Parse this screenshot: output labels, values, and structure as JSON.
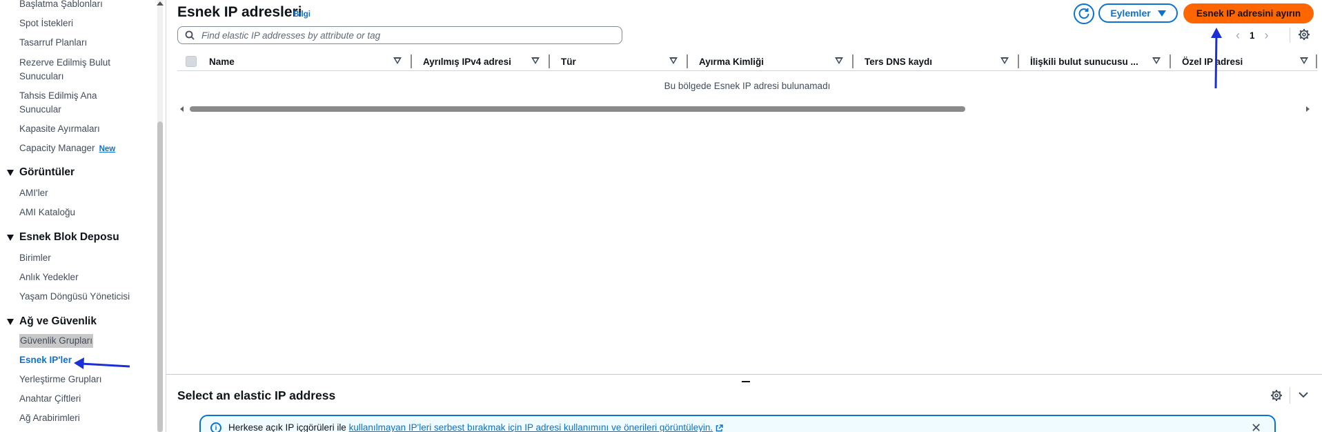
{
  "sidebar": {
    "items_top": [
      {
        "label": "Başlatma Şablonları"
      },
      {
        "label": "Spot İstekleri"
      },
      {
        "label": "Tasarruf Planları"
      },
      {
        "label": "Rezerve Edilmiş Bulut Sunucuları"
      },
      {
        "label": "Tahsis Edilmiş Ana Sunucular"
      },
      {
        "label": "Kapasite Ayırmaları"
      },
      {
        "label": "Capacity Manager",
        "badge": "New"
      }
    ],
    "sections": [
      {
        "title": "Görüntüler",
        "items": [
          "AMI'ler",
          "AMI Kataloğu"
        ]
      },
      {
        "title": "Esnek Blok Deposu",
        "items": [
          "Birimler",
          "Anlık Yedekler",
          "Yaşam Döngüsü Yöneticisi"
        ]
      },
      {
        "title": "Ağ ve Güvenlik",
        "items": [
          "Güvenlik Grupları",
          "Esnek IP'ler",
          "Yerleştirme Grupları",
          "Anahtar Çiftleri",
          "Ağ Arabirimleri"
        ]
      }
    ]
  },
  "main": {
    "title": "Esnek IP adresleri",
    "info_link": "Bilgi",
    "actions_label": "Eylemler",
    "allocate_label": "Esnek IP adresini ayırın",
    "search_placeholder": "Find elastic IP addresses by attribute or tag",
    "page_number": "1",
    "columns": [
      "Name",
      "Ayrılmış IPv4 adresi",
      "Tür",
      "Ayırma Kimliği",
      "Ters DNS kaydı",
      "İlişkili bulut sunucusu ...",
      "Özel IP adresi"
    ],
    "empty_message": "Bu bölgede Esnek IP adresi bulunamadı"
  },
  "split_panel": {
    "title": "Select an elastic IP address",
    "alert_prefix": "Herkese açık IP içgörüleri ile ",
    "alert_link": "kullanılmayan IP'leri serbest bırakmak için IP adresi kullanımını ve önerileri görüntüleyin."
  },
  "colors": {
    "accent": "#0972d3",
    "primary_button": "#ff6600",
    "annotation_arrow": "#1a2fd6"
  }
}
